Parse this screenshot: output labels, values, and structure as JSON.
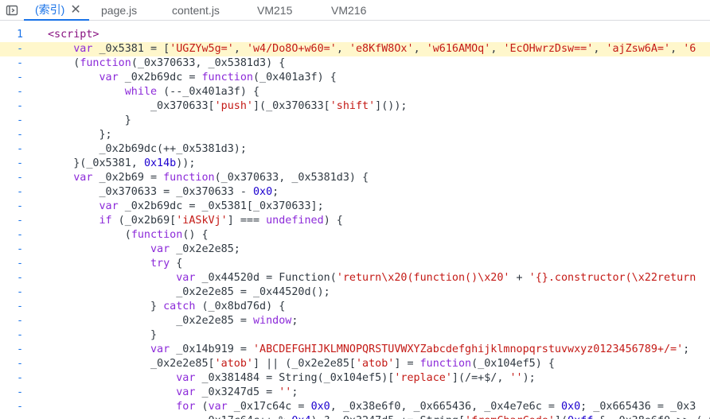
{
  "tabs": [
    {
      "label": "(索引)",
      "active": true
    },
    {
      "label": "page.js"
    },
    {
      "label": "content.js"
    },
    {
      "label": "VM215"
    },
    {
      "label": "VM216"
    }
  ],
  "gutter": {
    "first": "1",
    "rest": "-"
  },
  "lines": [
    "<script>",
    "    var _0x5381 = ['UGZYw5g=', 'w4/Do8O+w60=', 'e8KfW8Ox', 'w616AMOq', 'EcOHwrzDsw==', 'ajZsw6A=', '6",
    "    (function(_0x370633, _0x5381d3) {",
    "        var _0x2b69dc = function(_0x401a3f) {",
    "            while (--_0x401a3f) {",
    "                _0x370633['push'](_0x370633['shift']());",
    "            }",
    "        };",
    "        _0x2b69dc(++_0x5381d3);",
    "    }(_0x5381, 0x14b));",
    "    var _0x2b69 = function(_0x370633, _0x5381d3) {",
    "        _0x370633 = _0x370633 - 0x0;",
    "        var _0x2b69dc = _0x5381[_0x370633];",
    "        if (_0x2b69['iASkVj'] === undefined) {",
    "            (function() {",
    "                var _0x2e2e85;",
    "                try {",
    "                    var _0x44520d = Function('return\\x20(function()\\x20' + '{}.constructor(\\x22return",
    "                    _0x2e2e85 = _0x44520d();",
    "                } catch (_0x8bd76d) {",
    "                    _0x2e2e85 = window;",
    "                }",
    "                var _0x14b919 = 'ABCDEFGHIJKLMNOPQRSTUVWXYZabcdefghijklmnopqrstuvwxyz0123456789+/=';",
    "                _0x2e2e85['atob'] || (_0x2e2e85['atob'] = function(_0x104ef5) {",
    "                    var _0x381484 = String(_0x104ef5)['replace'](/=+$/, '');",
    "                    var _0x3247d5 = '';",
    "                    for (var _0x17c64c = 0x0, _0x38e6f0, _0x665436, _0x4e7e6c = 0x0; _0x665436 = _0x3",
    "                        _0x17c64c++ % 0x4) ? _0x3247d5 += String['fromCharCode'](0xff & _0x38e6f0 >> (-0x"
  ]
}
